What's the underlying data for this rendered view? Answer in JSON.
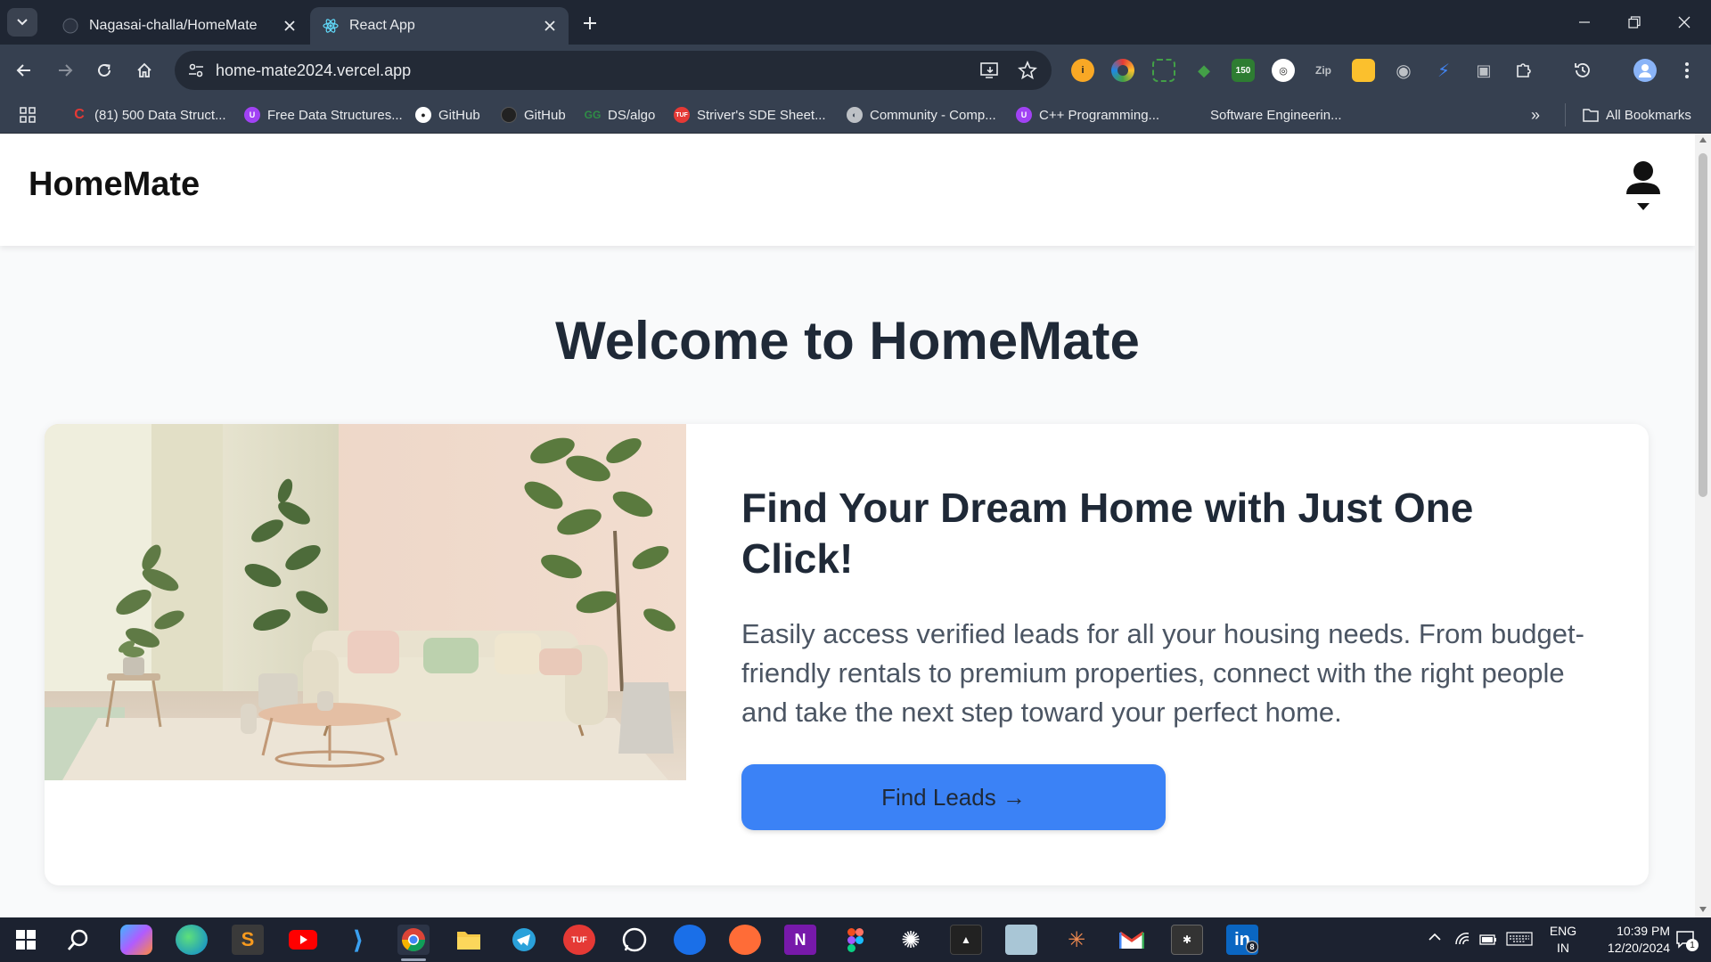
{
  "browser": {
    "tabs": [
      {
        "title": "Nagasai-challa/HomeMate",
        "active": false
      },
      {
        "title": "React App",
        "active": true
      }
    ],
    "url": "home-mate2024.vercel.app",
    "bookmarks": [
      {
        "label": "(81) 500 Data Struct...",
        "icon": "c-icon",
        "color": "#e53935"
      },
      {
        "label": "Free Data Structures...",
        "icon": "u-icon",
        "color": "#a142f4"
      },
      {
        "label": "GitHub",
        "icon": "github-icon",
        "color": "#ffffff"
      },
      {
        "label": "GitHub",
        "icon": "github-icon",
        "color": "#222222"
      },
      {
        "label": "DS/algo",
        "icon": "geeks-icon",
        "color": "#2f8d46"
      },
      {
        "label": "Striver's SDE Sheet...",
        "icon": "tuf-icon",
        "color": "#e53935"
      },
      {
        "label": "Community - Comp...",
        "icon": "globe-icon",
        "color": "#bdc1c6"
      },
      {
        "label": "C++ Programming...",
        "icon": "u-icon",
        "color": "#a142f4"
      },
      {
        "label": "Software Engineerin...",
        "icon": "microsoft-icon",
        "color": "#f25022"
      }
    ],
    "all_bookmarks": "All Bookmarks"
  },
  "app": {
    "brand": "HomeMate",
    "welcome": "Welcome to HomeMate",
    "hero": {
      "title": "Find Your Dream Home with Just One Click!",
      "description": "Easily access verified leads for all your housing needs. From budget-friendly rentals to premium properties, connect with the right people and take the next step toward your perfect home.",
      "button": "Find Leads →"
    },
    "accent_color": "#3b82f6"
  },
  "taskbar": {
    "apps": [
      "windows-start-icon",
      "search-icon",
      "copilot-icon",
      "edge-icon",
      "sublime-icon",
      "youtube-icon",
      "vscode-icon",
      "chrome-icon",
      "file-explorer-icon",
      "telegram-icon",
      "tuf-icon",
      "whatsapp-icon",
      "phone-link-icon",
      "postman-icon",
      "onenote-icon",
      "figma-icon",
      "chatgpt-icon",
      "app-icon",
      "app-icon",
      "app-icon",
      "gmail-icon",
      "app-icon",
      "linkedin-icon"
    ],
    "linkedin_badge": "8",
    "language": "ENG",
    "region": "IN",
    "time": "10:39 PM",
    "date": "12/20/2024",
    "notifications": "1"
  }
}
